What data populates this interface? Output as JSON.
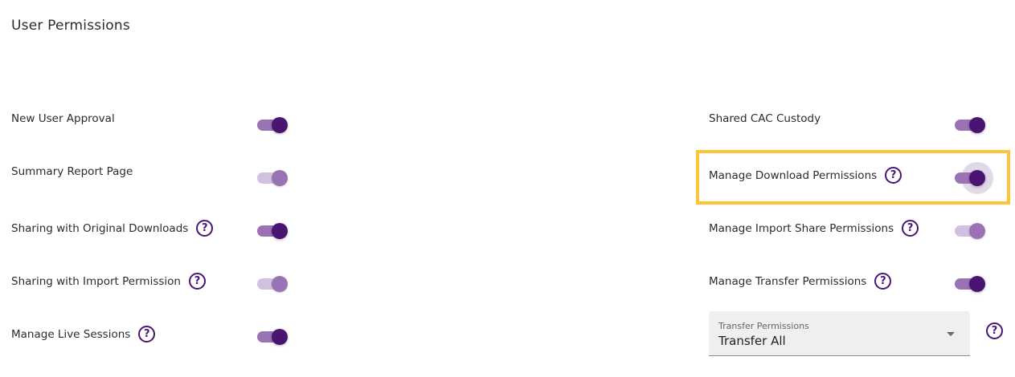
{
  "page": {
    "title": "User Permissions"
  },
  "colors": {
    "accent": "#4a1572",
    "track_on": "#9a73b5",
    "track_disabled": "#d2c0df",
    "highlight": "#fcc436"
  },
  "left_permissions": [
    {
      "label": "New User Approval",
      "has_help": false,
      "enabled": true,
      "disabled": false
    },
    {
      "label": "Summary Report Page",
      "has_help": false,
      "enabled": true,
      "disabled": true
    },
    {
      "label": "Sharing with Original Downloads",
      "has_help": true,
      "enabled": true,
      "disabled": false
    },
    {
      "label": "Sharing with Import Permission",
      "has_help": true,
      "enabled": true,
      "disabled": true
    },
    {
      "label": "Manage Live Sessions",
      "has_help": true,
      "enabled": true,
      "disabled": false
    }
  ],
  "right_permissions": [
    {
      "label": "Shared CAC Custody",
      "has_help": false,
      "enabled": true,
      "disabled": false
    },
    {
      "label": "Manage Download Permissions",
      "has_help": true,
      "enabled": true,
      "disabled": false,
      "highlighted": true
    },
    {
      "label": "Manage Import Share Permissions",
      "has_help": true,
      "enabled": true,
      "disabled": true
    },
    {
      "label": "Manage Transfer Permissions",
      "has_help": true,
      "enabled": true,
      "disabled": false
    }
  ],
  "transfer_select": {
    "label": "Transfer Permissions",
    "value": "Transfer All",
    "icon": "chevron-down-icon"
  },
  "icons": {
    "help": "?"
  }
}
